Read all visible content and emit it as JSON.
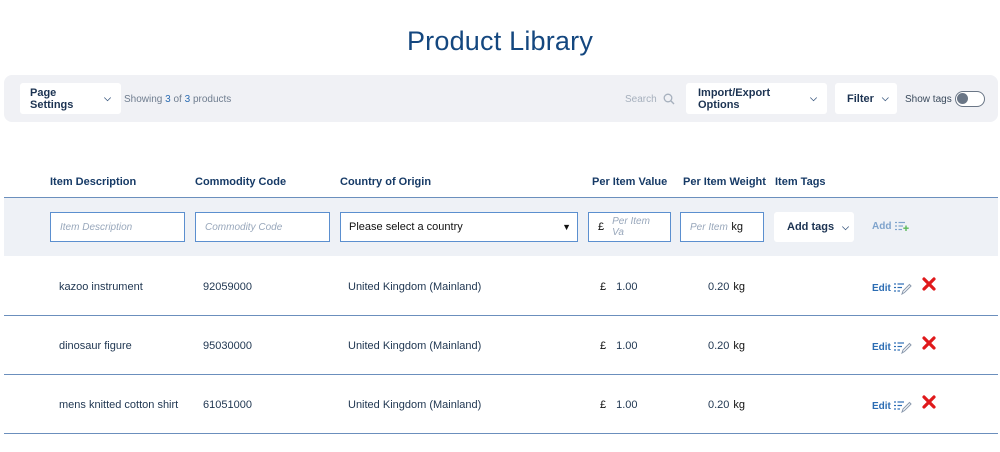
{
  "page": {
    "title": "Product Library"
  },
  "toolbar": {
    "page_settings_label": "Page Settings",
    "showing_prefix": "Showing",
    "showing_count": "3",
    "showing_of": "of",
    "showing_total": "3",
    "showing_suffix": "products",
    "search_placeholder": "Search",
    "import_export_label": "Import/Export Options",
    "filter_label": "Filter",
    "show_tags_label": "Show tags",
    "show_tags_on": false
  },
  "table": {
    "headers": {
      "item_description": "Item Description",
      "commodity_code": "Commodity Code",
      "country_of_origin": "Country of Origin",
      "per_item_value": "Per Item Value",
      "per_item_weight": "Per Item Weight",
      "item_tags": "Item Tags"
    },
    "filters": {
      "item_description_placeholder": "Item Description",
      "commodity_code_placeholder": "Commodity Code",
      "country_select_value": "Please select a country",
      "currency_symbol": "£",
      "value_placeholder": "Per Item Va",
      "weight_placeholder": "Per Item",
      "weight_unit": "kg",
      "add_tags_label": "Add tags",
      "add_label": "Add"
    },
    "rows": [
      {
        "description": "kazoo instrument",
        "code": "92059000",
        "country": "United Kingdom (Mainland)",
        "currency": "£",
        "value": "1.00",
        "weight": "0.20",
        "unit": "kg",
        "edit_label": "Edit"
      },
      {
        "description": "dinosaur figure",
        "code": "95030000",
        "country": "United Kingdom (Mainland)",
        "currency": "£",
        "value": "1.00",
        "weight": "0.20",
        "unit": "kg",
        "edit_label": "Edit"
      },
      {
        "description": "mens knitted cotton shirt",
        "code": "61051000",
        "country": "United Kingdom (Mainland)",
        "currency": "£",
        "value": "1.00",
        "weight": "0.20",
        "unit": "kg",
        "edit_label": "Edit"
      }
    ]
  },
  "colors": {
    "title": "#14477f",
    "accent": "#2b6cb3",
    "delete": "#e0191b",
    "toolbar_bg": "#f0f1f5"
  },
  "icons": {
    "search": "search-icon",
    "chevron": "chevron-down-icon",
    "edit": "edit-list-pencil-icon",
    "delete": "delete-x-icon",
    "add": "add-list-icon"
  }
}
